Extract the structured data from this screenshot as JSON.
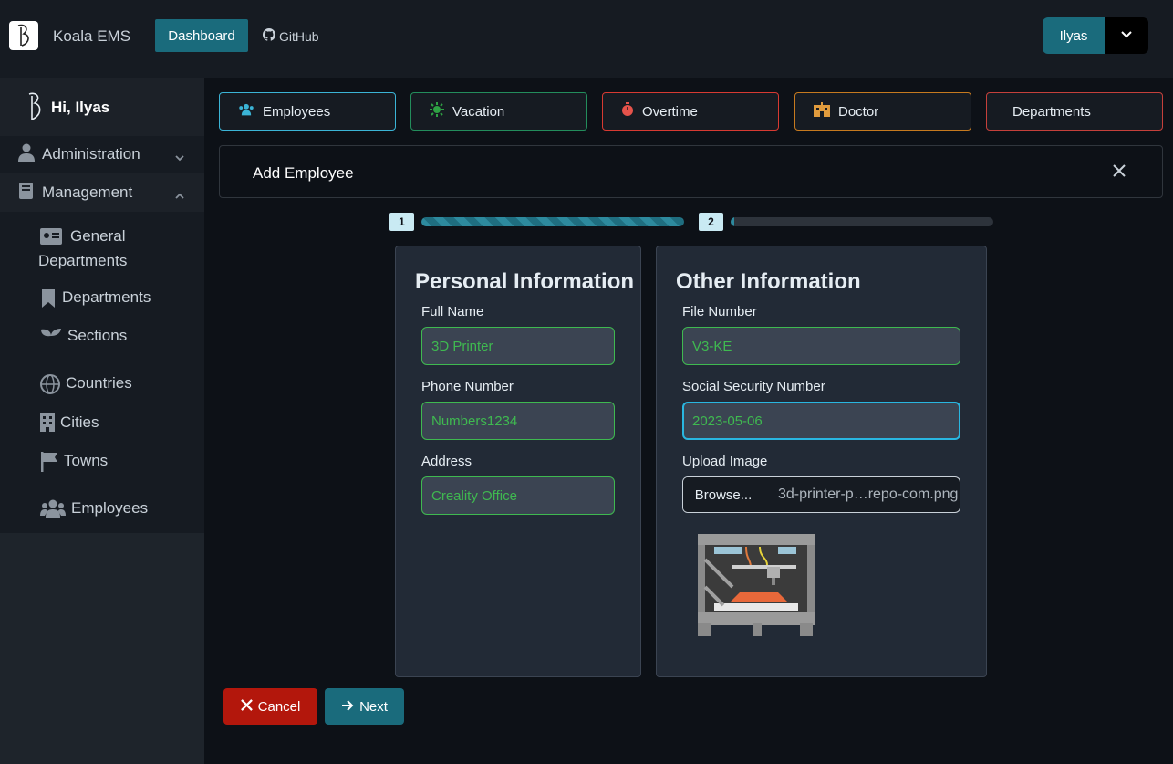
{
  "header": {
    "app_title": "Koala EMS",
    "dashboard_label": "Dashboard",
    "github_label": "GitHub",
    "user_label": "Ilyas"
  },
  "sidebar": {
    "greeting": "Hi, Ilyas",
    "sections": {
      "administration": "Administration",
      "management": "Management"
    },
    "items": {
      "general_departments_line1": "General",
      "general_departments_line2": "Departments",
      "departments": "Departments",
      "sections": "Sections",
      "countries": "Countries",
      "cities": "Cities",
      "towns": "Towns",
      "employees": "Employees"
    }
  },
  "tabs": {
    "employees": "Employees",
    "vacation": "Vacation",
    "overtime": "Overtime",
    "doctor": "Doctor",
    "departments": "Departments"
  },
  "tab_colors": {
    "employees": "#3bb4d6",
    "vacation": "#238d5c",
    "overtime": "#d73a32",
    "doctor": "#c67a1f",
    "departments": "#c5403b"
  },
  "panel": {
    "title": "Add Employee"
  },
  "stepper": {
    "step1": "1",
    "step2": "2",
    "step1_progress": 1.0,
    "step2_progress": 0.0
  },
  "personal": {
    "title": "Personal Information",
    "full_name_label": "Full Name",
    "full_name_value": "3D Printer",
    "phone_label": "Phone Number",
    "phone_value": "Numbers1234",
    "address_label": "Address",
    "address_value": "Creality Office"
  },
  "other": {
    "title": "Other Information",
    "file_number_label": "File Number",
    "file_number_value": "V3-KE",
    "ssn_label": "Social Security Number",
    "ssn_value": "2023-05-06",
    "upload_label": "Upload Image",
    "browse_label": "Browse...",
    "file_name": "3d-printer-p…repo-com.png"
  },
  "actions": {
    "cancel_label": "Cancel",
    "next_label": "Next"
  }
}
